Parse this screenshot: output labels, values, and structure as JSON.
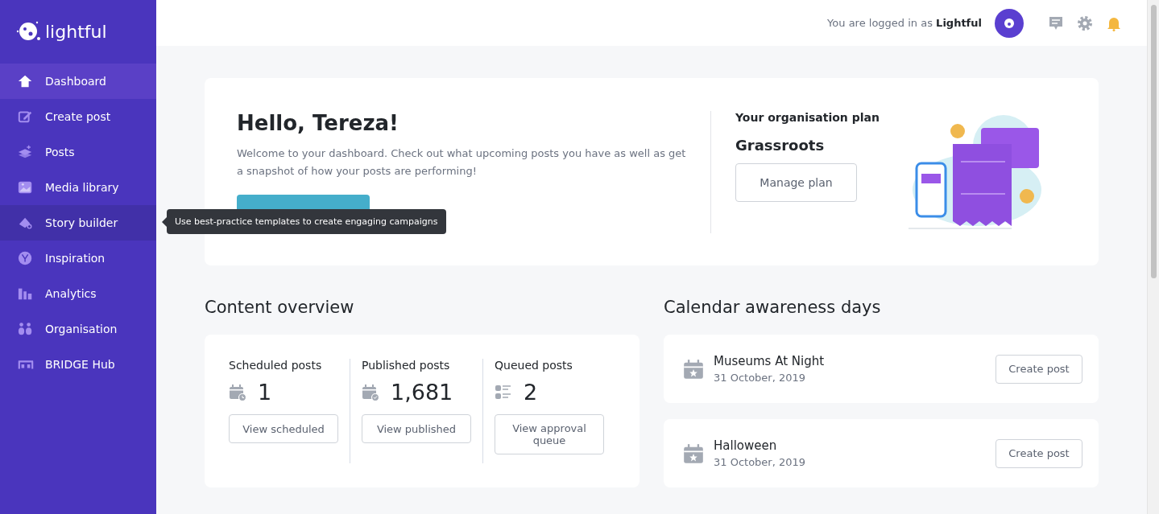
{
  "sidebar": {
    "logo": "lightful",
    "items": [
      {
        "label": "Dashboard",
        "selected": true,
        "hovered": false
      },
      {
        "label": "Create post",
        "selected": false,
        "hovered": false
      },
      {
        "label": "Posts",
        "selected": false,
        "hovered": false
      },
      {
        "label": "Media library",
        "selected": false,
        "hovered": false
      },
      {
        "label": "Story builder",
        "selected": false,
        "hovered": true
      },
      {
        "label": "Inspiration",
        "selected": false,
        "hovered": false
      },
      {
        "label": "Analytics",
        "selected": false,
        "hovered": false
      },
      {
        "label": "Organisation",
        "selected": false,
        "hovered": false
      },
      {
        "label": "BRIDGE Hub",
        "selected": false,
        "hovered": false
      }
    ]
  },
  "tooltip": "Use best-practice templates to create engaging campaigns",
  "header": {
    "login_prefix": "You are logged in as",
    "login_name": "Lightful"
  },
  "welcome": {
    "title": "Hello, Tereza!",
    "text": "Welcome to your dashboard. Check out what upcoming posts you have as well as get a snapshot of how your posts are performing!",
    "plan_label": "Your organisation plan",
    "plan_name": "Grassroots",
    "plan_button": "Manage plan"
  },
  "content_overview": {
    "title": "Content overview",
    "stats": [
      {
        "label": "Scheduled posts",
        "value": "1",
        "button": "View scheduled"
      },
      {
        "label": "Published posts",
        "value": "1,681",
        "button": "View published"
      },
      {
        "label": "Queued posts",
        "value": "2",
        "button": "View approval queue"
      }
    ]
  },
  "awareness_days": {
    "title": "Calendar awareness days",
    "items": [
      {
        "name": "Museums At Night",
        "date": "31 October, 2019",
        "button": "Create post"
      },
      {
        "name": "Halloween",
        "date": "31 October, 2019",
        "button": "Create post"
      }
    ]
  }
}
